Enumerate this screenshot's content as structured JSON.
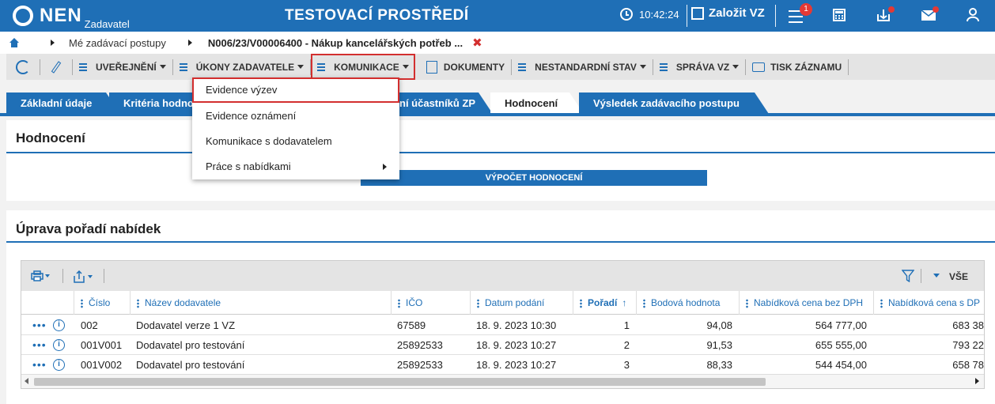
{
  "app": {
    "logo": "NEN",
    "logo_sub": "Zadavatel",
    "title": "TESTOVACÍ PROSTŘEDÍ",
    "time": "10:42:24",
    "create_label": "Založit VZ",
    "notifications_count": "1"
  },
  "breadcrumb": {
    "item1": "Mé zadávací postupy",
    "current": "N006/23/V00006400 - Nákup kancelářských potřeb ...",
    "close": "✖"
  },
  "toolbar": {
    "uverejneni": "UVEŘEJNĚNÍ",
    "ukony": "ÚKONY ZADAVATELE",
    "komunikace": "KOMUNIKACE",
    "dokumenty": "DOKUMENTY",
    "nestandardni": "NESTANDARDNÍ STAV",
    "sprava": "SPRÁVA VZ",
    "tisk": "TISK ZÁZNAMU"
  },
  "tabs": {
    "zakladni": "Základní údaje",
    "kriteria": "Kritéria hodno",
    "ucastnici": "ní účastníků ZP",
    "hodnoceni": "Hodnocení",
    "vysledek": "Výsledek zadávacího postupu"
  },
  "dropdown": {
    "items": [
      "Evidence výzev",
      "Evidence oznámení",
      "Komunikace s dodavatelem",
      "Práce s nabídkami"
    ]
  },
  "hodnoceni": {
    "title": "Hodnocení",
    "calc_button": "VÝPOČET HODNOCENÍ"
  },
  "poradi": {
    "title": "Úprava pořadí nabídek"
  },
  "grid": {
    "filter_all": "VŠE",
    "columns": [
      "Číslo",
      "Název dodavatele",
      "IČO",
      "Datum podání",
      "Pořadí",
      "Bodová hodnota",
      "Nabídková cena bez DPH",
      "Nabídková cena s DP"
    ],
    "rows": [
      [
        "002",
        "Dodavatel verze 1 VZ",
        "67589",
        "18. 9. 2023 10:30",
        "1",
        "94,08",
        "564 777,00",
        "683 38"
      ],
      [
        "001V001",
        "Dodavatel pro testování",
        "25892533",
        "18. 9. 2023 10:27",
        "2",
        "91,53",
        "655 555,00",
        "793 22"
      ],
      [
        "001V002",
        "Dodavatel pro testování",
        "25892533",
        "18. 9. 2023 10:27",
        "3",
        "88,33",
        "544 454,00",
        "658 78"
      ]
    ]
  },
  "colors": {
    "brand": "#1f6fb6",
    "highlight": "#d32f2f"
  }
}
